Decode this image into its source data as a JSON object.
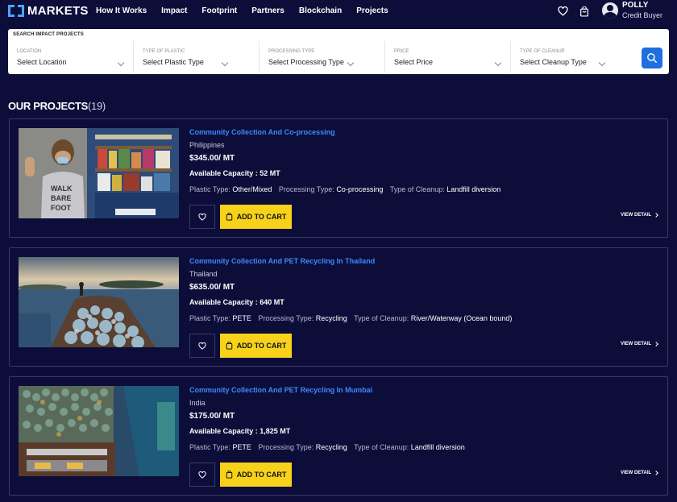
{
  "brand": {
    "name": "MARKETS"
  },
  "nav": {
    "links": [
      "How It Works",
      "Impact",
      "Footprint",
      "Partners",
      "Blockchain",
      "Projects"
    ]
  },
  "user": {
    "name": "POLLY",
    "role": "Credit Buyer"
  },
  "icons": {
    "favorites": "heart-icon",
    "cart": "cart-icon",
    "account": "avatar-icon",
    "search": "search-icon"
  },
  "search": {
    "title": "SEARCH IMPACT PROJECTS",
    "filters": [
      {
        "label": "LOCATION",
        "value": "Select Location"
      },
      {
        "label": "TYPE OF PLASTIC",
        "value": "Select Plastic Type"
      },
      {
        "label": "PROCESSING TYPE",
        "value": "Select Processing Type"
      },
      {
        "label": "PRICE",
        "value": "Select Price"
      },
      {
        "label": "TYPE OF CLEANUP",
        "value": "Select Cleanup Type"
      }
    ]
  },
  "projects_heading": {
    "title": "OUR PROJECTS",
    "count": "(19)"
  },
  "labels": {
    "plastic_type": "Plastic Type:",
    "processing_type": "Processing Type:",
    "cleanup_type_first": "Type of Cleanup:",
    "add_to_cart": "ADD TO CART",
    "view_detail": "VIEW DETAIL"
  },
  "projects": [
    {
      "title": "Community Collection And Co-processing",
      "country": "Philippines",
      "price": "$345.00/ MT",
      "capacity": "Available Capacity : 52 MT",
      "plastic": "Other/Mixed",
      "processing": "Co-processing",
      "cleanup": "Landfill diversion"
    },
    {
      "title": "Community Collection And PET Recycling In Thailand",
      "country": "Thailand",
      "price": "$635.00/ MT",
      "capacity": "Available Capacity : 640 MT",
      "plastic": "PETE",
      "processing": "Recycling",
      "cleanup": "River/Waterway (Ocean bound)"
    },
    {
      "title": "Community Collection And PET Recycling In Mumbai",
      "country": "India",
      "price": "$175.00/ MT",
      "capacity": "Available Capacity : 1,825 MT",
      "plastic": "PETE",
      "processing": "Recycling",
      "cleanup": "Landfill diversion"
    }
  ]
}
